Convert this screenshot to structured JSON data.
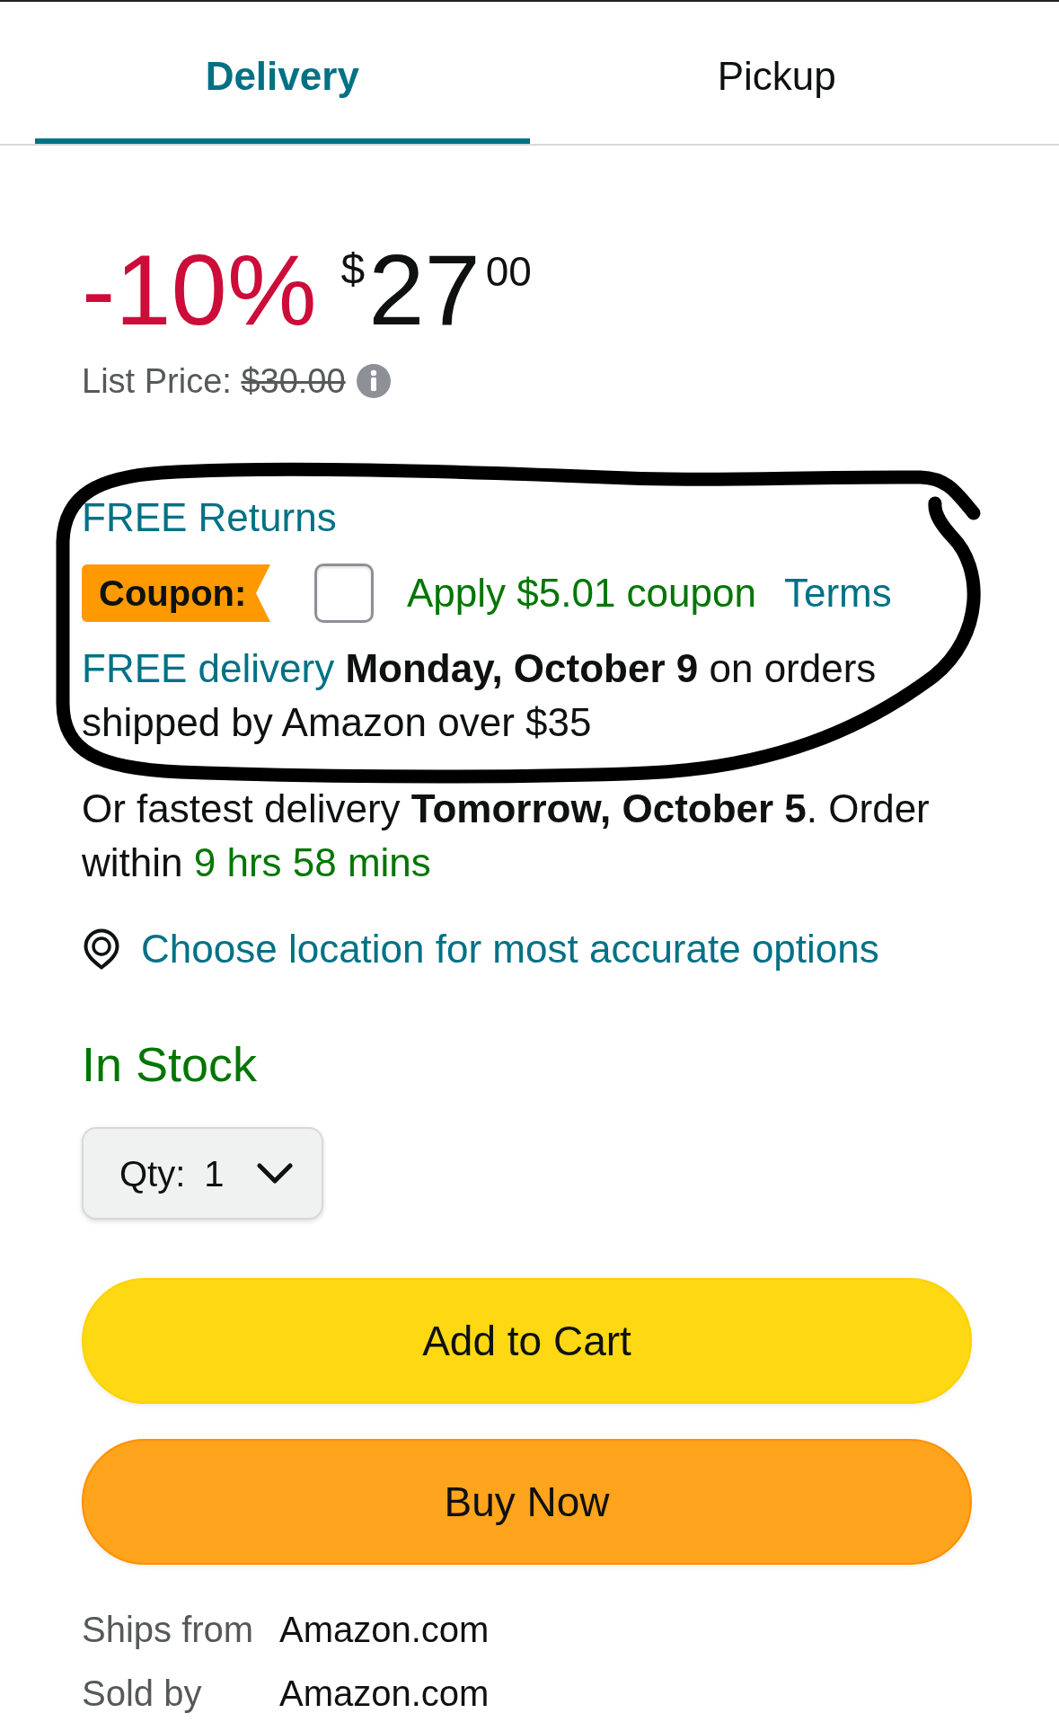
{
  "tabs": [
    {
      "label": "Delivery",
      "selected": true
    },
    {
      "label": "Pickup",
      "selected": false
    }
  ],
  "price": {
    "discount": "-10%",
    "currency": "$",
    "whole": "27",
    "fraction": "00"
  },
  "list_price": {
    "label": "List Price:",
    "value": "$30.00"
  },
  "returns_link": "FREE Returns",
  "coupon": {
    "badge": "Coupon:",
    "checked": false,
    "label": "Apply $5.01 coupon",
    "terms": "Terms"
  },
  "delivery": {
    "link": "FREE delivery",
    "text": "**Monday, October 9** on orders shipped by Amazon over $35"
  },
  "fastest": {
    "text": "Or fastest delivery **Tomorrow, October 5**. Order within",
    "countdown": "9 hrs 58 mins"
  },
  "location_link": "Choose location for most accurate options",
  "stock": "In Stock",
  "quantity": {
    "label": "Qty:",
    "value": "1"
  },
  "buttons": [
    {
      "label": "Add to Cart",
      "kind": "cart"
    },
    {
      "label": "Buy Now",
      "kind": "buy"
    }
  ],
  "seller_info": [
    {
      "label": "Ships from",
      "value": "Amazon.com"
    },
    {
      "label": "Sold by",
      "value": "Amazon.com"
    }
  ]
}
